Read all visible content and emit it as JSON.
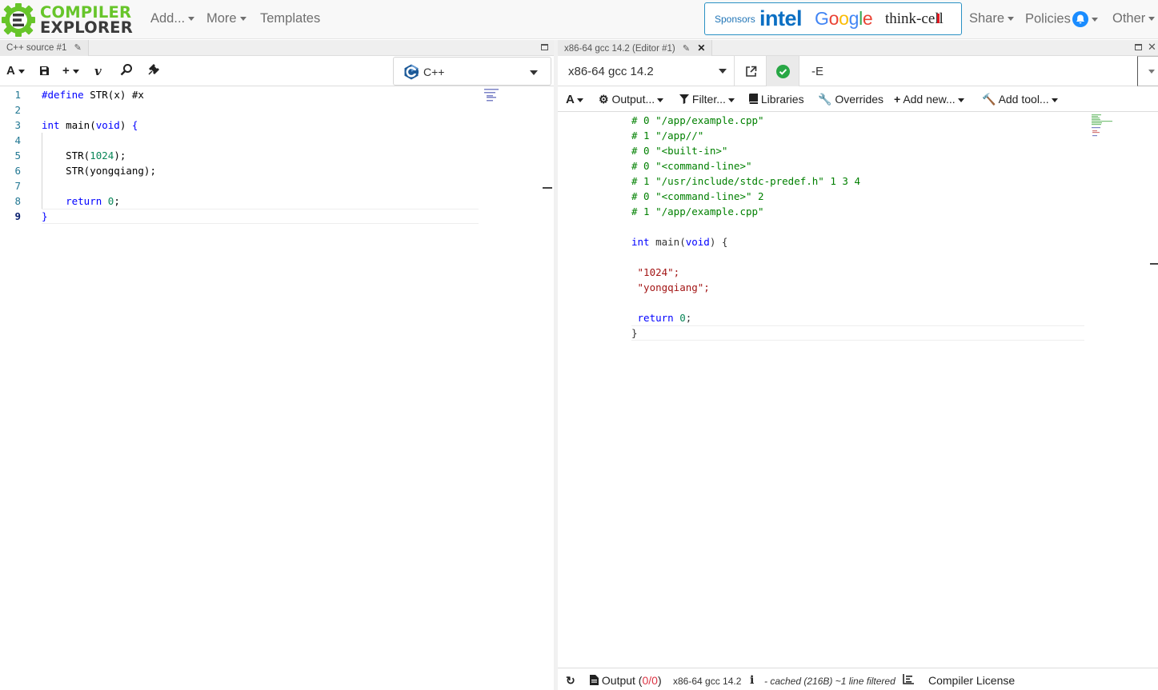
{
  "brand": {
    "line1": "COMPILER",
    "line2": "EXPLORER"
  },
  "nav": {
    "add": "Add...",
    "more": "More",
    "templates": "Templates",
    "share": "Share",
    "policies": "Policies",
    "other": "Other"
  },
  "sponsors": {
    "label": "Sponsors",
    "names": [
      "intel",
      "Google",
      "think-cell"
    ]
  },
  "source_pane": {
    "tab_title": "C++ source #1",
    "language": "C++",
    "lines": [
      {
        "n": "1",
        "text": "#define STR(x) #x"
      },
      {
        "n": "2",
        "text": ""
      },
      {
        "n": "3",
        "text": "int main(void) {"
      },
      {
        "n": "4",
        "text": ""
      },
      {
        "n": "5",
        "text": "    STR(1024);"
      },
      {
        "n": "6",
        "text": "    STR(yongqiang);"
      },
      {
        "n": "7",
        "text": ""
      },
      {
        "n": "8",
        "text": "    return 0;"
      },
      {
        "n": "9",
        "text": "}"
      }
    ]
  },
  "compiler_pane": {
    "tab_title": "x86-64 gcc 14.2 (Editor #1)",
    "compiler": "x86-64 gcc 14.2",
    "flags": "-E",
    "options": {
      "output": "Output...",
      "filter": "Filter...",
      "libraries": "Libraries",
      "overrides": "Overrides",
      "add_new": "Add new...",
      "add_tool": "Add tool..."
    },
    "output_lines": [
      "# 0 \"/app/example.cpp\"",
      "# 1 \"/app//\"",
      "# 0 \"<built-in>\"",
      "# 0 \"<command-line>\"",
      "# 1 \"/usr/include/stdc-predef.h\" 1 3 4",
      "# 0 \"<command-line>\" 2",
      "# 1 \"/app/example.cpp\"",
      "",
      "int main(void) {",
      "",
      " \"1024\";",
      " \"yongqiang\";",
      "",
      " return 0;",
      "}"
    ],
    "status": {
      "output_label": "Output (",
      "output_count": "0/0",
      "output_close": ")",
      "compiler": "x86-64 gcc 14.2",
      "cache_info": "- cached (216B) ~1 line filtered",
      "license": "Compiler License"
    }
  },
  "colors": {
    "brand_green": "#67c52a",
    "keyword": "#0000ff",
    "number": "#098658",
    "string": "#a31515",
    "comment": "#008000",
    "ok": "#28a745"
  }
}
